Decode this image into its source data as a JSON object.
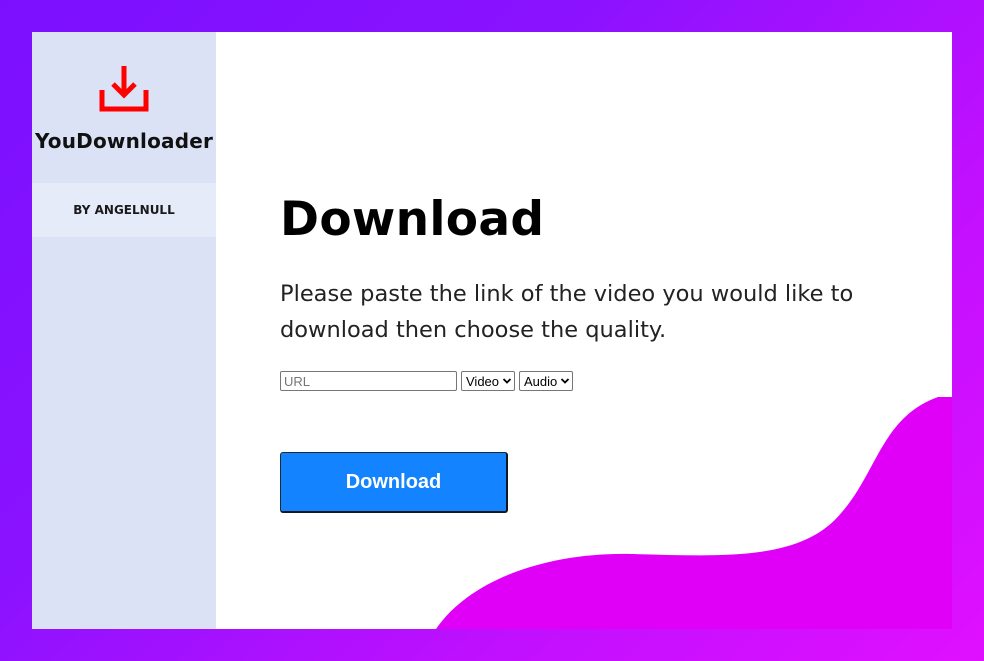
{
  "app": {
    "name": "YouDownloader",
    "byline": "BY ANGELNULL",
    "logo_icon": "download-icon",
    "logo_color": "#ff0000"
  },
  "main": {
    "title": "Download",
    "description": "Please paste the link of the video you would like to download then choose the quality.",
    "url_input": {
      "value": "",
      "placeholder": "URL"
    },
    "video_select": {
      "selected": "Video"
    },
    "audio_select": {
      "selected": "Audio"
    },
    "download_button": "Download"
  },
  "colors": {
    "background_gradient_start": "#7b10ff",
    "background_gradient_end": "#e010ff",
    "blob": "#e000f8",
    "sidebar": "#dce2f5",
    "byline_bg": "#e6ebf9",
    "button": "#1383ff"
  }
}
